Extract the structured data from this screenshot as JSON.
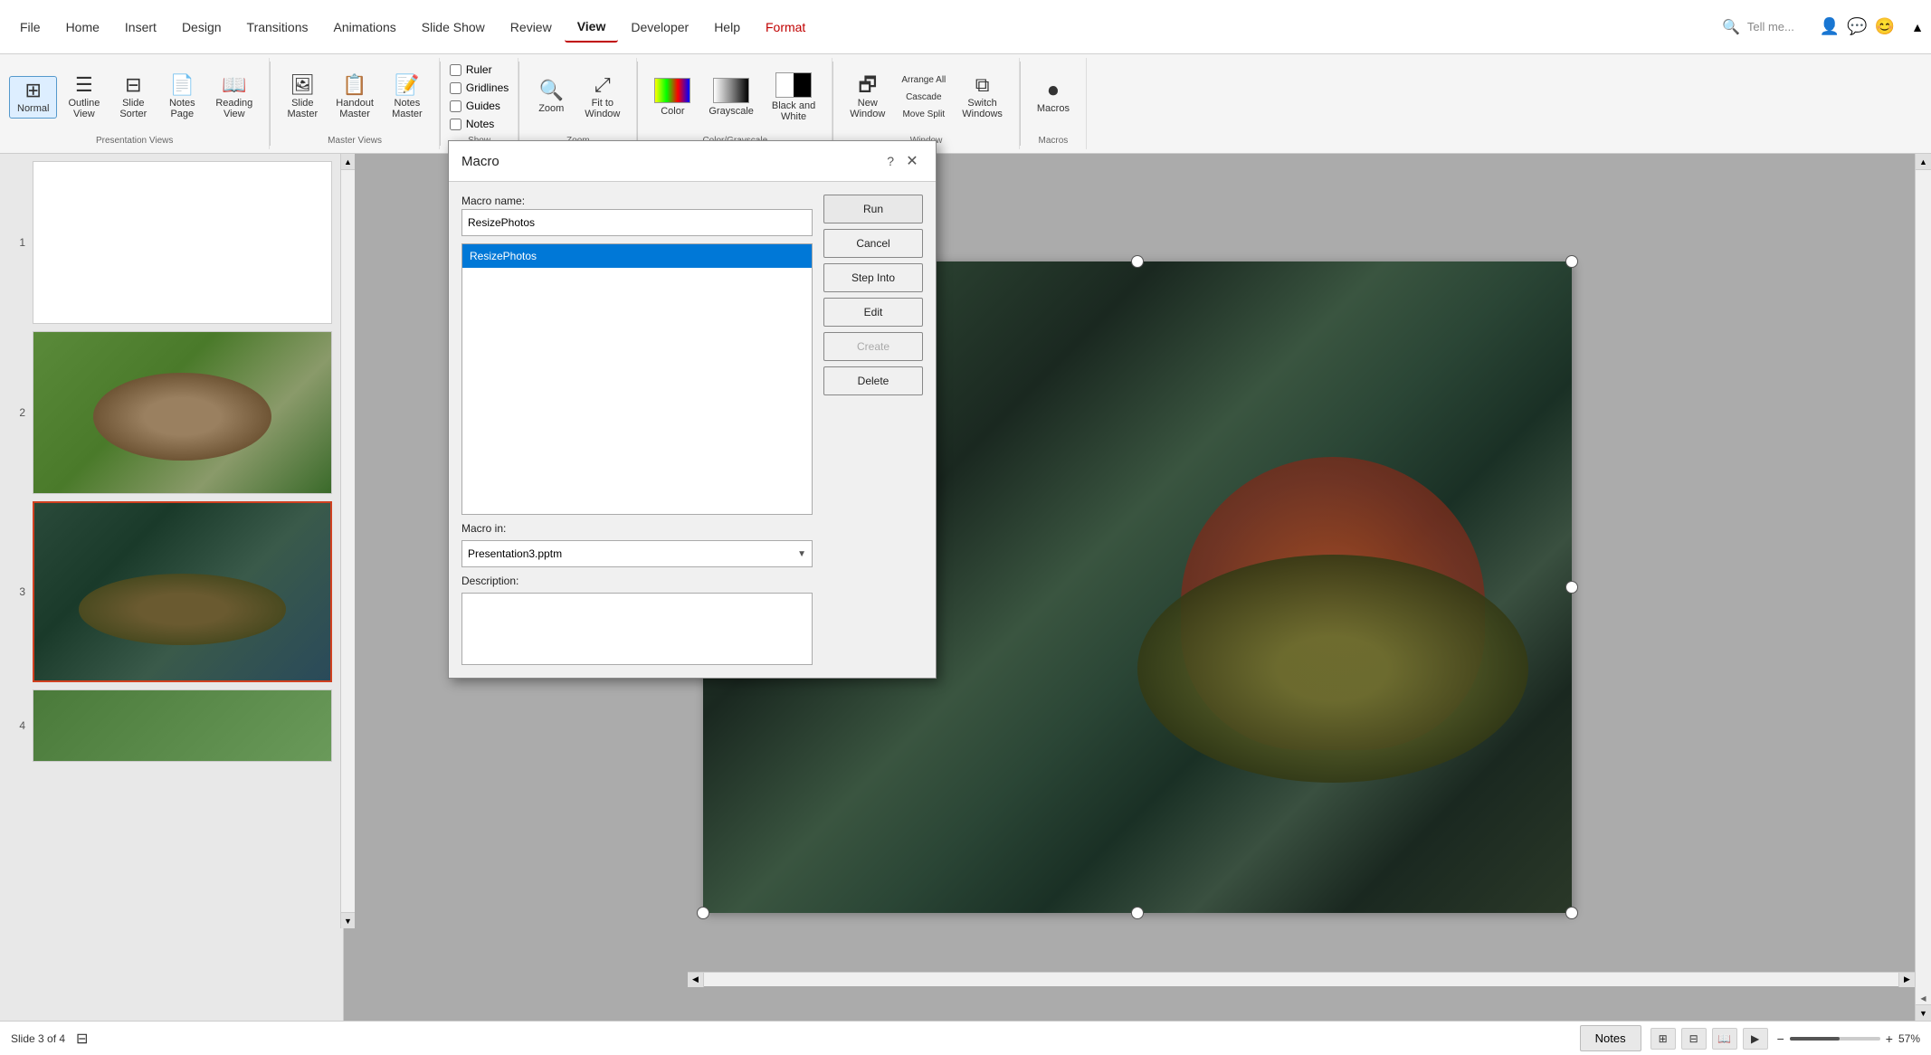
{
  "menubar": {
    "items": [
      "File",
      "Home",
      "Insert",
      "Design",
      "Transitions",
      "Animations",
      "Slide Show",
      "Review",
      "View",
      "Developer",
      "Help",
      "Format"
    ],
    "active": "View",
    "format_color": "#c00000",
    "search_placeholder": "Tell me..."
  },
  "ribbon": {
    "presentation_views": {
      "label": "Presentation Views",
      "buttons": [
        "Normal",
        "Outline View",
        "Slide Sorter",
        "Notes Page",
        "Reading View"
      ]
    },
    "master_views": {
      "label": "Master Views",
      "buttons": [
        "Slide Master",
        "Handout Master",
        "Notes Master"
      ]
    },
    "show": {
      "label": "Show",
      "checkboxes": [
        "Ruler",
        "Gridlines",
        "Guides",
        "Notes"
      ]
    },
    "zoom": {
      "label": "Zoom",
      "buttons": [
        "Zoom",
        "Fit to Window"
      ]
    },
    "color": {
      "label": "Color/Grayscale",
      "buttons": [
        "Color",
        "Grayscale",
        "Black and White"
      ]
    },
    "window": {
      "label": "Window",
      "buttons": [
        "New Window",
        "Arrange All",
        "Cascade",
        "Move Split",
        "Switch Windows"
      ]
    },
    "macros": {
      "label": "Macros",
      "buttons": [
        "Macros"
      ]
    }
  },
  "slides": [
    {
      "number": "1",
      "type": "blank"
    },
    {
      "number": "2",
      "type": "turtle_brown"
    },
    {
      "number": "3",
      "type": "turtle_water",
      "selected": true
    },
    {
      "number": "4",
      "type": "blank_partial"
    }
  ],
  "dialog": {
    "title": "Macro",
    "macro_name_label": "Macro name:",
    "macro_name_value": "ResizePhotos",
    "macro_list": [
      "ResizePhotos"
    ],
    "selected_macro": "ResizePhotos",
    "buttons": [
      "Run",
      "Cancel",
      "Step Into",
      "Edit",
      "Create",
      "Delete"
    ],
    "macro_in_label": "Macro in:",
    "macro_in_value": "Presentation3.pptm",
    "description_label": "Description:",
    "description_value": ""
  },
  "statusbar": {
    "slide_info": "Slide 3 of 4",
    "notes_label": "Notes",
    "zoom_level": "57%",
    "zoom_value": 57
  }
}
